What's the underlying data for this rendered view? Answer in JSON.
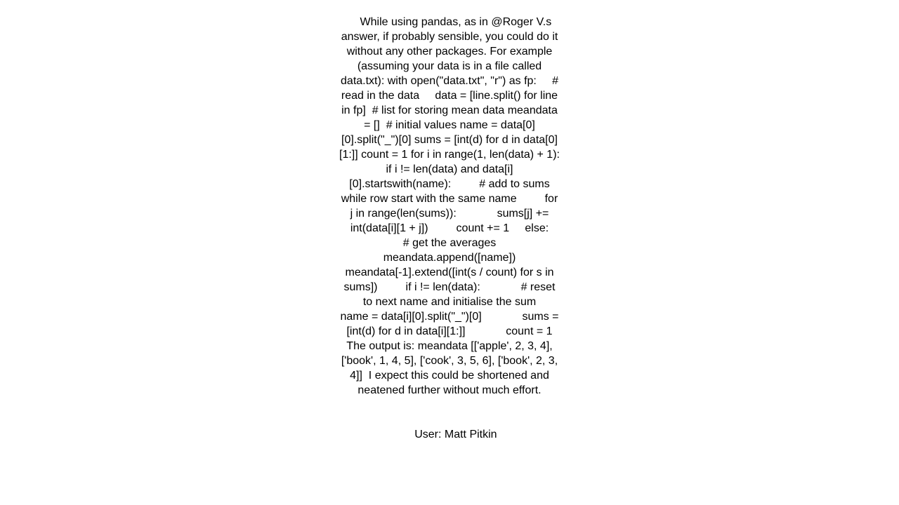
{
  "page": {
    "background_color": "#ffffff",
    "text_color": "#000000"
  },
  "answer": {
    "body": "While using pandas, as in @Roger V.s answer, if probably sensible, you could do it without any other packages. For example (assuming your data is in a file called data.txt): with open(\"data.txt\", \"r\") as fp:     # read in the data     data = [line.split() for line in fp]  # list for storing mean data meandata = []  # initial values name = data[0][0].split(\"_\")[0] sums = [int(d) for d in data[0][1:]] count = 1 for i in range(1, len(data) + 1):     if i != len(data) and data[i][0].startswith(name):         # add to sums while row start with the same name         for j in range(len(sums)):             sums[j] += int(data[i][1 + j])         count += 1     else:        # get the averages         meandata.append([name])         meandata[-1].extend([int(s / count) for s in sums])         if i != len(data):             # reset to next name and initialise the sum             name = data[i][0].split(\"_\")[0]             sums = [int(d) for d in data[i][1:]]             count = 1  The output is: meandata [['apple', 2, 3, 4], ['book', 1, 4, 5], ['cook', 3, 5, 6], ['book', 2, 3, 4]]  I expect this could be shortened and neatened further without much effort.",
    "attribution": "User: Matt Pitkin"
  }
}
